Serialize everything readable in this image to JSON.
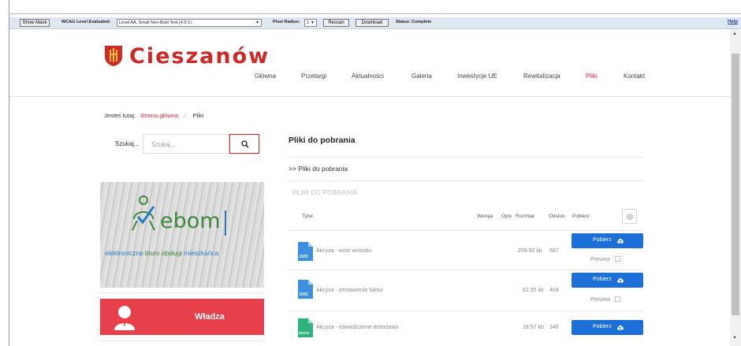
{
  "wcag": {
    "show_mask_label": "Show Mask",
    "level_label": "WCAG Level Evaluated:",
    "level_value": "Level AA, Small Non-Bold Text (4.5:1)",
    "radius_label": "Pixel Radius:",
    "radius_value": "1",
    "rescan_label": "Rescan",
    "download_label": "Download",
    "status_label": "Status: Complete",
    "help_label": "Help"
  },
  "site": {
    "brand": "Cieszanów",
    "brand_color": "#cd2a27",
    "accent_color": "#e0203b",
    "nav": [
      {
        "label": "Główna"
      },
      {
        "label": "Przetargi"
      },
      {
        "label": "Aktualności"
      },
      {
        "label": "Galeria"
      },
      {
        "label": "Inwestycje UE"
      },
      {
        "label": "Rewitalizacja"
      },
      {
        "label": "Pliki",
        "active": true
      },
      {
        "label": "Kontakt"
      }
    ]
  },
  "breadcrumb": {
    "prefix": "Jesteś tutaj:",
    "home": "Strona główna",
    "separator": "/",
    "current": "Pliki"
  },
  "search": {
    "label": "Szukaj...",
    "placeholder": "Szukaj..."
  },
  "sidebar": {
    "ebom_word": "ebom",
    "ebom_tag_1": "elektroniczne ",
    "ebom_tag_2": "biuro obsługi",
    "ebom_tag_3": " mieszkańca",
    "wladza_label": "Władza",
    "wladza_color": "#e8404a"
  },
  "main": {
    "title": "Pliki do pobrania",
    "subtitle": ">> Pliki do pobrania",
    "section": "PLIKI DO POBRANIA",
    "columns": {
      "title": "Tytuł",
      "version": "Wersja",
      "description": "Opis",
      "size": "Rozmiar",
      "views": "Odsłon",
      "download": "Pobierz"
    },
    "files": [
      {
        "name": "Akcyza - wzór wniosku",
        "type": "DOC",
        "size": "209.92 kb",
        "views": "687",
        "button": "Pobierz",
        "preview": "Preview"
      },
      {
        "name": "Akcyza - zestawienie faktur",
        "type": "DOC",
        "size": "61.95 kb",
        "views": "404",
        "button": "Pobierz",
        "preview": "Preview"
      },
      {
        "name": "Akcyza - oświadczenie dzierżawa",
        "type": "DOCX",
        "size": "18.57 kb",
        "views": "346",
        "button": "Pobierz"
      }
    ],
    "button_color": "#1b6fd6"
  }
}
